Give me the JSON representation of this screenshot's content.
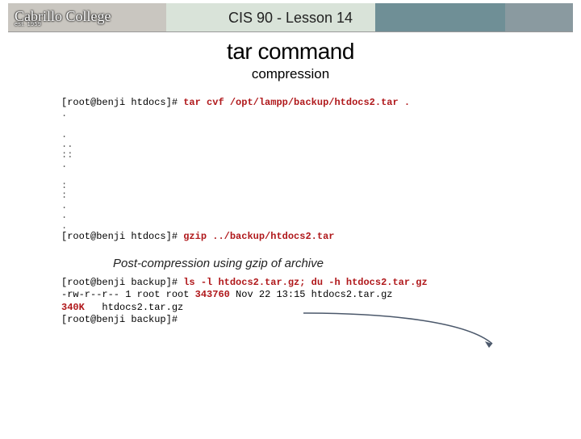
{
  "banner": {
    "logo_text": "Cabrillo College",
    "logo_sub": "est. 1959",
    "title": "CIS 90 - Lesson 14"
  },
  "heading": "tar command",
  "subheading": "compression",
  "term1": {
    "prompt": "[root@benji htdocs]# ",
    "cmd": "tar cvf /opt/lampp/backup/htdocs2.tar ."
  },
  "snip_lines": [
    ".",
    "",
    ".",
    "..",
    "::",
    ".",
    "",
    " :",
    " :",
    ".",
    ".",
    "."
  ],
  "term2": {
    "prompt": "[root@benji htdocs]# ",
    "cmd": "gzip ../backup/htdocs2.tar"
  },
  "caption": "Post-compression using gzip of archive",
  "result": {
    "prompt1": "[root@benji backup]# ",
    "cmd1": "ls -l htdocs2.tar.gz; du -h htdocs2.tar.gz",
    "line2a": "-rw-r--r-- 1 root root ",
    "size_bytes": "343760",
    "line2b": " Nov 22 13:15 htdocs2.tar.gz",
    "size_human": "340K",
    "line3b": "   htdocs2.tar.gz",
    "prompt2": "[root@benji backup]#"
  }
}
